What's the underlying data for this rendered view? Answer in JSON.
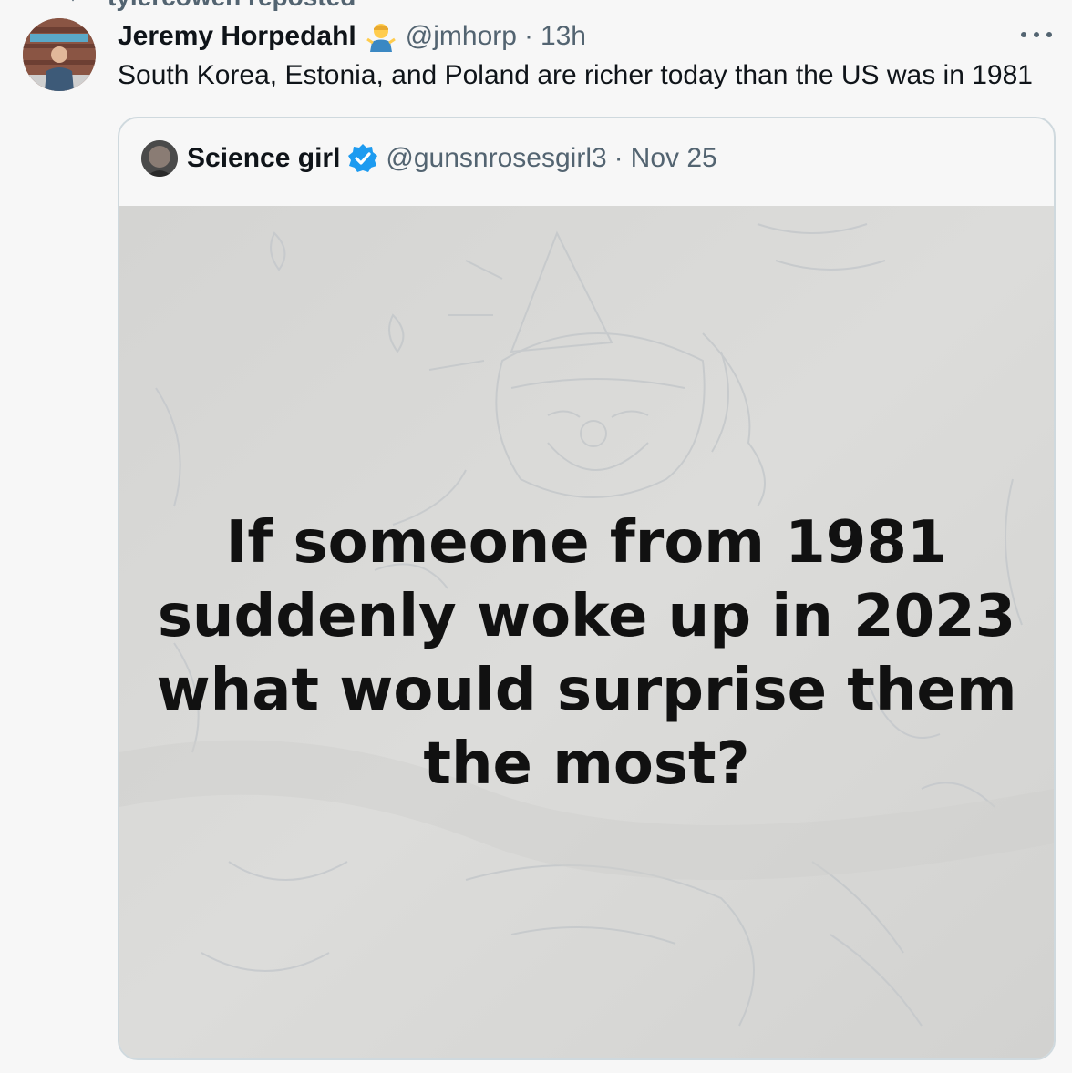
{
  "repost": {
    "label": "tylercowen reposted",
    "icon": "repost-icon"
  },
  "tweet": {
    "author": {
      "display_name": "Jeremy Horpedahl",
      "emoji": "man-shrugging-emoji",
      "handle": "@jmhorp",
      "separator": "·",
      "time": "13h"
    },
    "text": "South Korea, Estonia, and Poland are richer today than the US was in 1981",
    "more_icon": "more-horizontal-icon"
  },
  "quote": {
    "author": {
      "display_name": "Science girl",
      "verified_icon": "verified-badge-icon",
      "handle": "@gunsnrosesgirl3",
      "separator": "·",
      "time": "Nov 25"
    },
    "media": {
      "lines": [
        "If someone from 1981",
        "suddenly woke up in 2023",
        "what would surprise them",
        "the most?"
      ]
    }
  },
  "colors": {
    "background": "#f7f7f7",
    "text_primary": "#0f1419",
    "text_secondary": "#536471",
    "border": "#cfd9de",
    "verified_blue": "#1d9bf0"
  }
}
